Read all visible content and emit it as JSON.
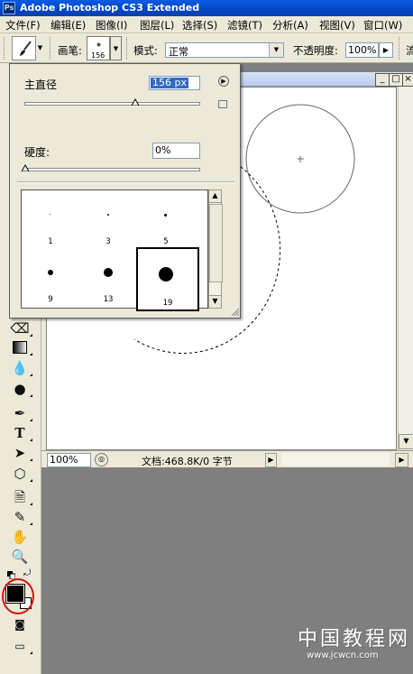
{
  "app": {
    "title": "Adobe Photoshop CS3 Extended",
    "logo_text": "Ps"
  },
  "menu": [
    "文件(F)",
    "编辑(E)",
    "图像(I)",
    "图层(L)",
    "选择(S)",
    "滤镜(T)",
    "分析(A)",
    "视图(V)",
    "窗口(W)"
  ],
  "options_bar": {
    "brush_label": "画笔:",
    "brush_size_small": "156",
    "mode_label": "模式:",
    "mode_value": "正常",
    "opacity_label": "不透明度:",
    "opacity_value": "100%",
    "flow_label_cut": "流"
  },
  "brush_panel": {
    "diameter_label": "主直径",
    "diameter_value": "156 px",
    "hardness_label": "硬度:",
    "hardness_value": "0%",
    "presets": [
      {
        "size_label": "1"
      },
      {
        "size_label": "3"
      },
      {
        "size_label": "5"
      },
      {
        "size_label": "9"
      },
      {
        "size_label": "13"
      },
      {
        "size_label": "19",
        "selected": true
      }
    ]
  },
  "document": {
    "zoom": "100%",
    "info": "文档:468.8K/0 字节"
  },
  "watermark": {
    "name": "中国教程网",
    "url": "www.jcwcn.com"
  }
}
